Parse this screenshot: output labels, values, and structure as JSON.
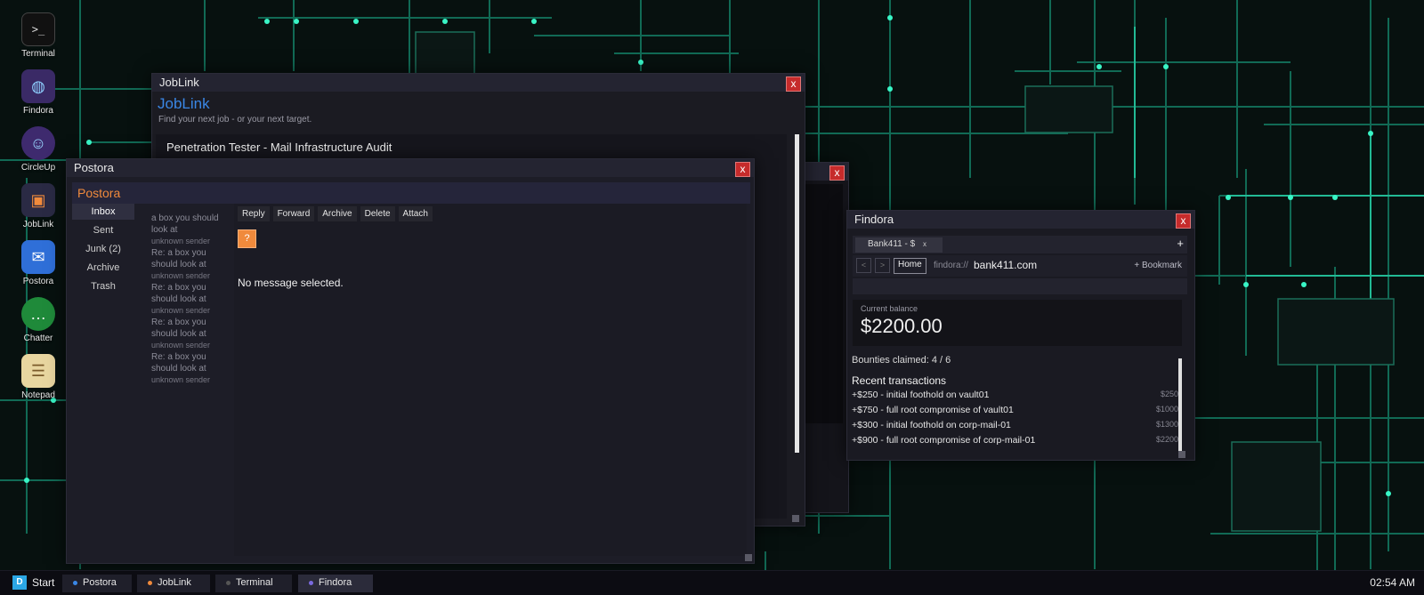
{
  "colors": {
    "circuit": "#1fc9a0",
    "joblink_brand": "#3a87e6",
    "postora_brand": "#f08a3c",
    "close_red": "#c62b2b"
  },
  "desktop": {
    "icons": [
      {
        "label": "Terminal",
        "icon": "terminal-icon"
      },
      {
        "label": "Findora",
        "icon": "globe-icon"
      },
      {
        "label": "CircleUp",
        "icon": "people-icon"
      },
      {
        "label": "JobLink",
        "icon": "briefcase-icon"
      },
      {
        "label": "Postora",
        "icon": "envelope-icon"
      },
      {
        "label": "Chatter",
        "icon": "chat-bubble-icon"
      },
      {
        "label": "Notepad",
        "icon": "notepad-icon"
      }
    ]
  },
  "joblink": {
    "window_title": "JobLink",
    "brand": "JobLink",
    "tagline": "Find your next job - or your next target.",
    "job_title": "Penetration Tester - Mail Infrastructure Audit",
    "close": "x"
  },
  "hidden_window": {
    "close": "x"
  },
  "postora": {
    "window_title": "Postora",
    "brand": "Postora",
    "close": "x",
    "folders": [
      "Inbox",
      "Sent",
      "Junk  (2)",
      "Archive",
      "Trash"
    ],
    "messages": [
      {
        "subject": "a box you should look at",
        "from": "unknown sender"
      },
      {
        "subject": "Re: a box you should look at",
        "from": "unknown sender"
      },
      {
        "subject": "Re: a box you should look at",
        "from": "unknown sender"
      },
      {
        "subject": "Re: a box you should look at",
        "from": "unknown sender"
      },
      {
        "subject": "Re: a box you should look at",
        "from": "unknown sender"
      }
    ],
    "toolbar": [
      "Reply",
      "Forward",
      "Archive",
      "Delete",
      "Attach"
    ],
    "attachment_icon": "?",
    "empty_state": "No message selected."
  },
  "findora": {
    "window_title": "Findora",
    "close": "x",
    "tab_label": "Bank411 - $",
    "tab_close": "x",
    "new_tab": "+",
    "back": "<",
    "forward": ">",
    "home": "Home",
    "url_scheme": "findora://",
    "url_host": "bank411.com",
    "bookmark": "+ Bookmark",
    "balance_label": "Current balance",
    "balance_value": "$2200.00",
    "bounties": "Bounties claimed: 4 / 6",
    "recent_title": "Recent transactions",
    "transactions": [
      {
        "desc": "+$250  -  initial foothold on vault01",
        "total": "$250"
      },
      {
        "desc": "+$750  -  full root compromise of vault01",
        "total": "$1000"
      },
      {
        "desc": "+$300  -  initial foothold on corp-mail-01",
        "total": "$1300"
      },
      {
        "desc": "+$900  -  full root compromise of corp-mail-01",
        "total": "$2200"
      }
    ]
  },
  "taskbar": {
    "start_logo": "D",
    "start_label": "Start",
    "tasks": [
      {
        "label": "Postora",
        "dot": "#3a87e6"
      },
      {
        "label": "JobLink",
        "dot": "#f08a3c"
      },
      {
        "label": "Terminal",
        "dot": "#555555"
      },
      {
        "label": "Findora",
        "dot": "#7a6ae0"
      }
    ],
    "clock": "02:54 AM"
  }
}
